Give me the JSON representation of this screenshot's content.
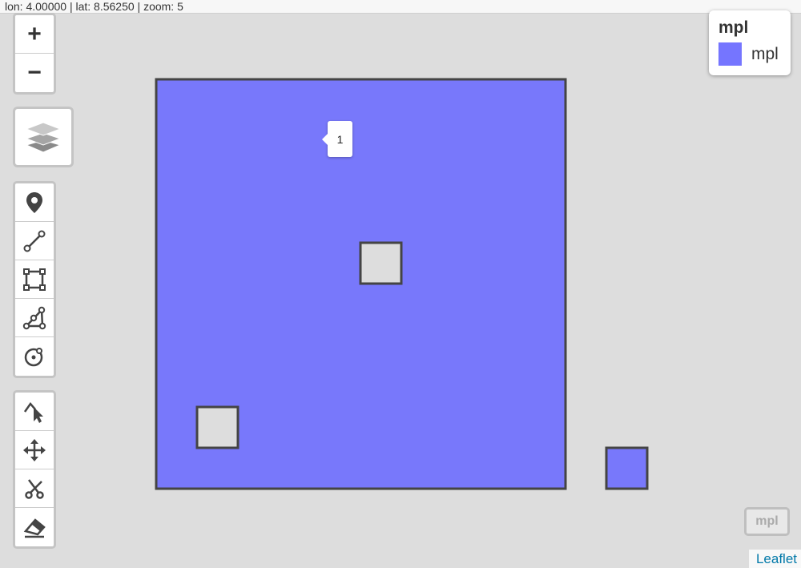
{
  "status_bar": {
    "text": "lon: 4.00000 | lat: 8.56250 | zoom: 5"
  },
  "zoom_control": {
    "zoom_in": "+",
    "zoom_out": "−"
  },
  "layers_control": {
    "icon": "layers-icon"
  },
  "draw_toolbar": {
    "tools": [
      {
        "icon": "marker-icon"
      },
      {
        "icon": "polyline-icon"
      },
      {
        "icon": "rectangle-icon"
      },
      {
        "icon": "polygon-icon"
      },
      {
        "icon": "circle-icon"
      }
    ]
  },
  "edit_toolbar": {
    "tools": [
      {
        "icon": "edit-vertices-icon"
      },
      {
        "icon": "drag-icon"
      },
      {
        "icon": "cut-icon"
      },
      {
        "icon": "eraser-icon"
      }
    ]
  },
  "legend": {
    "title": "mpl",
    "entries": [
      {
        "label": "mpl",
        "color": "#6666ff"
      }
    ]
  },
  "popup": {
    "text": "1"
  },
  "mpl_toggle": {
    "label": "mpl"
  },
  "attribution": {
    "text": "Leaflet"
  },
  "colors": {
    "polygon_fill": "#7878fb",
    "polygon_stroke": "#444444",
    "hole_fill": "#dddddd"
  }
}
